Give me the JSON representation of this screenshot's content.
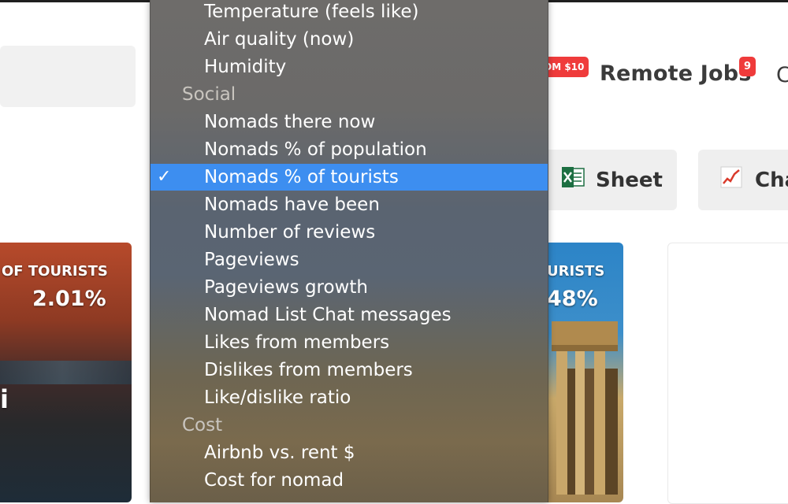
{
  "header": {
    "promo_badge": "ОМ $10",
    "remote_jobs_label": "Remote Jobs",
    "remote_jobs_count": "9",
    "cut_off_letter": "C"
  },
  "toolbar": {
    "sheet_label": "Sheet",
    "chart_label": "Cha"
  },
  "cards": [
    {
      "label": "OF TOURISTS",
      "value": "2.01%",
      "city_initial": "i"
    },
    {
      "label": "URISTS",
      "value": "48%"
    }
  ],
  "dropdown": {
    "items": [
      {
        "type": "option",
        "label": "Temperature (feels like)"
      },
      {
        "type": "option",
        "label": "Air quality (now)"
      },
      {
        "type": "option",
        "label": "Humidity"
      },
      {
        "type": "header",
        "label": "Social"
      },
      {
        "type": "option",
        "label": "Nomads there now"
      },
      {
        "type": "option",
        "label": "Nomads % of population"
      },
      {
        "type": "option",
        "label": "Nomads % of tourists",
        "selected": true
      },
      {
        "type": "option",
        "label": "Nomads have been"
      },
      {
        "type": "option",
        "label": "Number of reviews"
      },
      {
        "type": "option",
        "label": "Pageviews"
      },
      {
        "type": "option",
        "label": "Pageviews growth"
      },
      {
        "type": "option",
        "label": "Nomad List Chat messages"
      },
      {
        "type": "option",
        "label": "Likes from members"
      },
      {
        "type": "option",
        "label": "Dislikes from members"
      },
      {
        "type": "option",
        "label": "Like/dislike ratio"
      },
      {
        "type": "header",
        "label": "Cost"
      },
      {
        "type": "option",
        "label": "Airbnb vs. rent $"
      },
      {
        "type": "option",
        "label": "Cost for nomad"
      }
    ],
    "check_glyph": "✓"
  },
  "colors": {
    "accent_selected": "#3d8ef0",
    "badge_red": "#ef3b3b"
  },
  "icons": [
    "excel-sheet-icon",
    "chart-icon",
    "checkmark-icon"
  ]
}
